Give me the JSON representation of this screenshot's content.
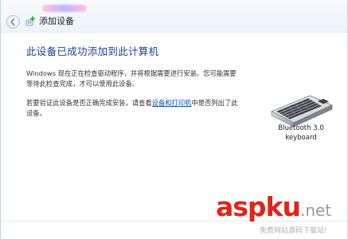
{
  "window": {
    "title": "添加设备"
  },
  "main": {
    "heading": "此设备已成功添加到此计算机",
    "para1": "Windows 现在正在检查驱动程序，并将根据需要进行安装。您可能需要等待此检查完成，才可以使用此设备。",
    "para2_before": "若要验证此设备是否正确完成安装，请查看",
    "para2_link": "设备和打印机",
    "para2_after": "中是否列出了此设备。"
  },
  "device": {
    "name_line1": "Bluetooth 3.0",
    "name_line2": "keyboard",
    "icon": "keyboard-icon"
  },
  "watermark": {
    "logo_part1": "asp",
    "logo_part2": "ku",
    "logo_part3": ".net",
    "subtitle": "免费网站源码下载站!"
  }
}
